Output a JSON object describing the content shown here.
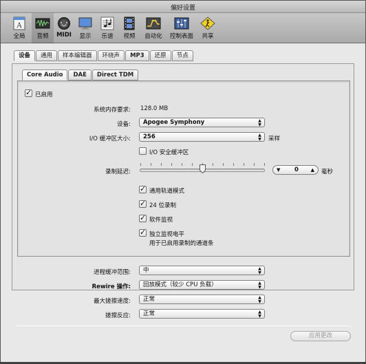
{
  "window": {
    "title": "偏好设置"
  },
  "toolbar": {
    "items": [
      {
        "label": "全局",
        "icon": "global-preferences-icon",
        "selected": false
      },
      {
        "label": "音频",
        "icon": "audio-icon",
        "selected": true
      },
      {
        "label": "MIDI",
        "icon": "midi-icon",
        "selected": false
      },
      {
        "label": "显示",
        "icon": "display-icon",
        "selected": false
      },
      {
        "label": "乐谱",
        "icon": "score-icon",
        "selected": false
      },
      {
        "label": "视频",
        "icon": "video-icon",
        "selected": false
      },
      {
        "label": "自动化",
        "icon": "automation-icon",
        "selected": false
      },
      {
        "label": "控制表面",
        "icon": "control-surface-icon",
        "selected": false
      },
      {
        "label": "共享",
        "icon": "sharing-icon",
        "selected": false
      }
    ]
  },
  "main_tabs": [
    "设备",
    "通用",
    "样本编辑器",
    "环绕声",
    "MP3",
    "还原",
    "节点"
  ],
  "driver_tabs": [
    "Core Audio",
    "DAE",
    "Direct TDM"
  ],
  "core_audio": {
    "enabled_label": "已启用",
    "enabled": true,
    "memory_label": "系统内存要求:",
    "memory_value": "128.0 MB",
    "device_label": "设备:",
    "device_value": "Apogee Symphony",
    "buffer_label": "I/O 缓冲区大小:",
    "buffer_value": "256",
    "buffer_unit": "采样",
    "safety_buffer_label": "I/O 安全缓冲区",
    "safety_buffer_checked": false,
    "record_delay_label": "录制延迟:",
    "record_delay_value": "0",
    "record_delay_slider_fraction": 0.5,
    "record_delay_unit": "毫秒",
    "universal_track_label": "通用轨道模式",
    "universal_track_checked": true,
    "bit24_label": "24 位录制",
    "bit24_checked": true,
    "software_monitor_label": "软件监视",
    "software_monitor_checked": true,
    "independent_monitor_label": "独立监视电平",
    "independent_monitor_sub": "用于已启用录制的通道条",
    "independent_monitor_checked": true
  },
  "global_settings": {
    "process_buffer_label": "进程缓冲范围:",
    "process_buffer_value": "中",
    "rewire_label": "Rewire 操作:",
    "rewire_value": "回放模式（较少 CPU 负载）",
    "scrub_speed_label": "最大搓擦速度:",
    "scrub_speed_value": "正常",
    "scrub_response_label": "搓擦反应:",
    "scrub_response_value": "正常"
  },
  "apply_button": "应用更改"
}
